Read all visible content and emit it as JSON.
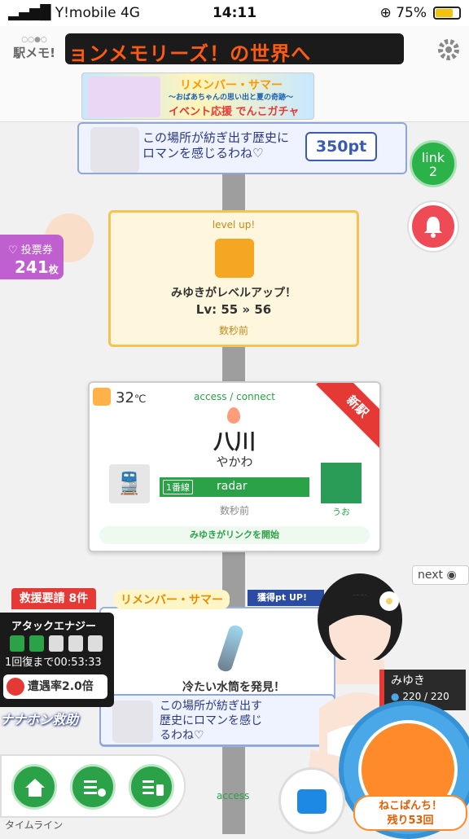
{
  "status_bar": {
    "carrier": "Y!mobile",
    "network": "4G",
    "time": "14:11",
    "battery": "75%",
    "battery_level": 0.75
  },
  "header": {
    "logo_text": "駅メモ!",
    "marquee": "ョンメモリーズ！の世界へ",
    "banner": {
      "title": "リメンバー・サマー",
      "subtitle": "〜おばあちゃんの思い出と夏の奇跡〜",
      "cta": "イベント応援 でんこガチャ"
    }
  },
  "quote_top": {
    "text": "この場所が紡ぎ出す歴史に\nロマンを感じるわね♡",
    "points": "350pt"
  },
  "link_button": {
    "label": "link",
    "count": "2"
  },
  "vote": {
    "label": "投票券",
    "count": "241",
    "unit": "枚"
  },
  "level_card": {
    "heading": "level up!",
    "text": "みゆきがレベルアップ！",
    "level": "Lv: 55 » 56",
    "time": "数秒前"
  },
  "station_card": {
    "temperature": "32",
    "temp_unit": "℃",
    "access": "access / connect",
    "new_badge": "新駅",
    "station_name": "八川",
    "station_kana": "やかわ",
    "line_number": "1番線",
    "line_name": "radar",
    "partner_name": "うお",
    "time": "数秒前",
    "link_status": "みゆきがリンクを開始"
  },
  "next_label": "next",
  "event_tag": "リメンバー・サマー",
  "pt_up": "獲得pt UP!",
  "item_card": {
    "text": "冷たい水筒を発見！"
  },
  "quote_bottom": {
    "text": "この場所が紡ぎ出す\n歴史にロマンを感じ\nるわね♡"
  },
  "rescue": {
    "label": "救援要請 8件"
  },
  "attack": {
    "title": "アタックエナジー",
    "recover": "1回復まで00:53:33",
    "rate": "遭遇率2.0倍",
    "segments_filled": 2,
    "segments_total": 5
  },
  "nanahon": "ナナホン救助",
  "denko": {
    "name": "みゆき",
    "hp": "220 / 220"
  },
  "neko": {
    "label1": "ねこぱんち！",
    "label2": "残り53回"
  },
  "bottom_nav": {
    "timeline": "タイムライン",
    "access": "access"
  },
  "colors": {
    "green": "#2ba148",
    "red": "#e53935",
    "blue": "#3a5bb5",
    "orange": "#ff8a2a"
  }
}
